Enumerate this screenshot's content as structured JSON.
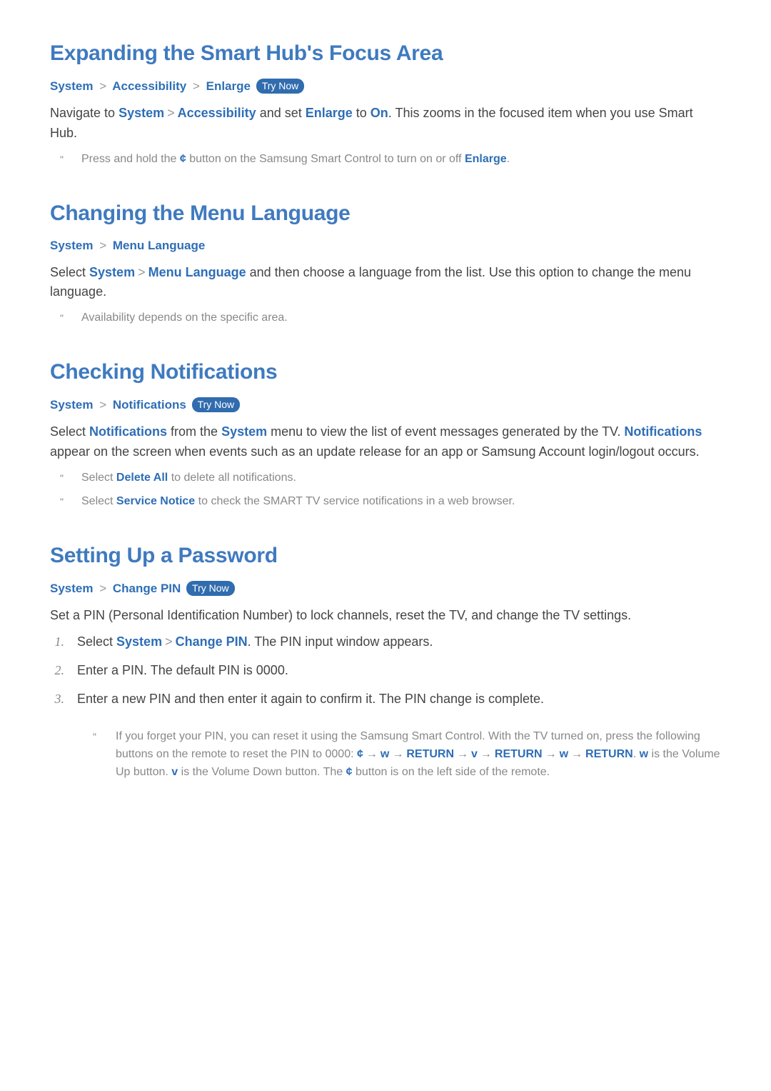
{
  "try_now_label": "Try Now",
  "sec1": {
    "title": "Expanding the Smart Hub's Focus Area",
    "crumb1": "System",
    "crumb2": "Accessibility",
    "crumb3": "Enlarge",
    "p_a": "Navigate to ",
    "p_b": "System",
    "p_c": "Accessibility",
    "p_d": " and set ",
    "p_e": "Enlarge",
    "p_f": " to ",
    "p_g": "On",
    "p_h": ". This zooms in the focused item when you use Smart Hub.",
    "note_a": "Press and hold the ",
    "note_sym": "¢",
    "note_b": " button on the Samsung Smart Control to turn on or off ",
    "note_c": "Enlarge",
    "note_d": "."
  },
  "sec2": {
    "title": "Changing the Menu Language",
    "crumb1": "System",
    "crumb2": "Menu Language",
    "p_a": "Select ",
    "p_b": "System",
    "p_c": "Menu Language",
    "p_d": " and then choose a language from the list. Use this option to change the menu language.",
    "note": "Availability depends on the specific area."
  },
  "sec3": {
    "title": "Checking Notifications",
    "crumb1": "System",
    "crumb2": "Notifications",
    "p_a": "Select ",
    "p_b": "Notifications",
    "p_c": " from the ",
    "p_d": "System",
    "p_e": " menu to view the list of event messages generated by the TV. ",
    "p_f": "Notifications",
    "p_g": " appear on the screen when events such as an update release for an app or Samsung Account login/logout occurs.",
    "note1_a": "Select ",
    "note1_b": "Delete All",
    "note1_c": " to delete all notifications.",
    "note2_a": "Select ",
    "note2_b": "Service Notice",
    "note2_c": " to check the SMART TV service notifications in a web browser."
  },
  "sec4": {
    "title": "Setting Up a Password",
    "crumb1": "System",
    "crumb2": "Change PIN",
    "intro": "Set a PIN (Personal Identification Number) to lock channels, reset the TV, and change the TV settings.",
    "step1_a": "Select ",
    "step1_b": "System",
    "step1_c": "Change PIN",
    "step1_d": ". The PIN input window appears.",
    "step2": "Enter a PIN. The default PIN is 0000.",
    "step3": "Enter a new PIN and then enter it again to confirm it. The PIN change is complete.",
    "nn_a": "If you forget your PIN, you can reset it using the Samsung Smart Control. With the TV turned on, press the following buttons on the remote to reset the PIN to 0000: ",
    "nn_sym_c": "¢",
    "nn_sym_w": "w",
    "nn_sym_v": "v",
    "nn_return": "RETURN",
    "nn_b": ". ",
    "nn_c": " is the Volume Up button. ",
    "nn_d": " is the Volume Down button. The ",
    "nn_e": " button is on the left side of the remote."
  },
  "step_numbers": {
    "n1": "1.",
    "n2": "2.",
    "n3": "3."
  },
  "chevron": ">",
  "arrow": "→"
}
